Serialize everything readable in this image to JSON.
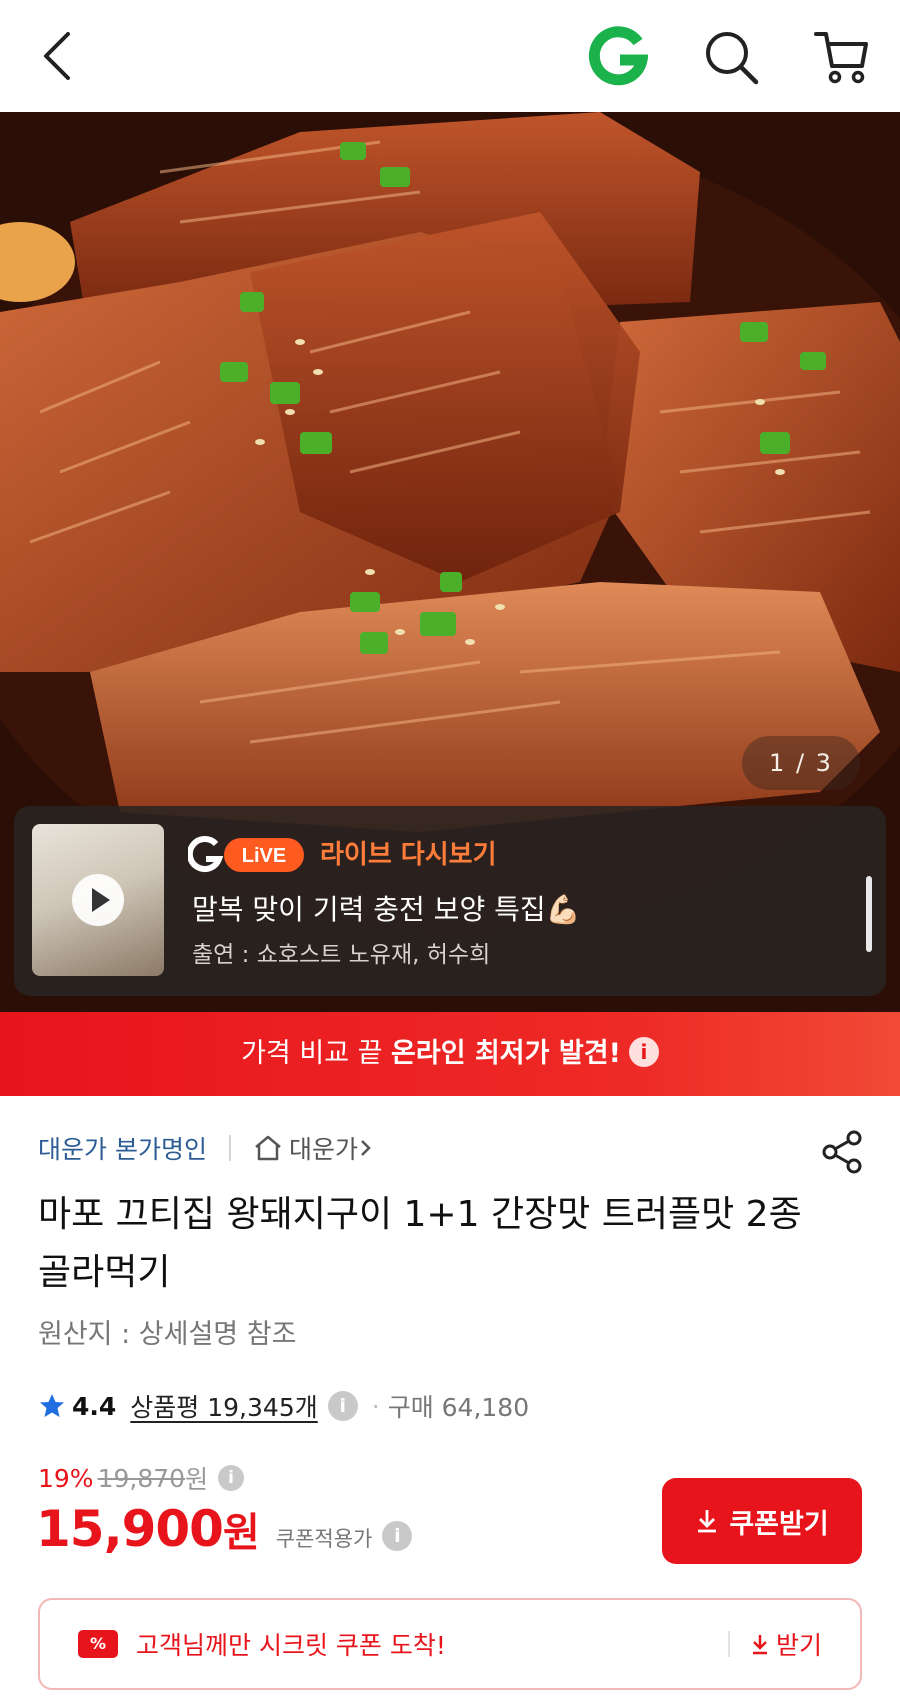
{
  "header": {
    "back_icon": "chevron-left-icon",
    "logo_letter": "G",
    "search_icon": "search-icon",
    "cart_icon": "cart-icon",
    "brand_green": "#1cb24b"
  },
  "gallery": {
    "current": "1",
    "total": "3",
    "indicator": "1 / 3"
  },
  "live": {
    "logo_g": "G",
    "logo_live": "LiVE",
    "replay_label": "라이브 다시보기",
    "title": "말복 맞이 기력 충전 보양 특집💪🏻",
    "cast": "출연 : 쇼호스트 노유재, 허수희"
  },
  "banner": {
    "prefix": "가격 비교 끝 ",
    "highlight": "온라인 최저가 발견!",
    "info": "i"
  },
  "product": {
    "seller": "대운가 본가명인",
    "store": "대운가",
    "title": "마포 끄티집 왕돼지구이 1+1 간장맛 트러플맛 2종 골라먹기",
    "origin": "원산지 : 상세설명 참조",
    "rating": "4.4",
    "review_label": "상품평 19,345개",
    "purchase": "구매 64,180",
    "discount_rate": "19%",
    "original_price": "19,870",
    "original_unit": "원",
    "price": "15,900",
    "price_unit": "원",
    "coupon_applied": "쿠폰적용가",
    "coupon_button": "쿠폰받기"
  },
  "secret_coupon": {
    "badge": "%",
    "message": "고객님께만 시크릿 쿠폰 도착!",
    "action": "받기"
  },
  "colors": {
    "accent_red": "#e8141c",
    "seller_blue": "#2d5d94",
    "live_orange": "#ff7d3a"
  }
}
